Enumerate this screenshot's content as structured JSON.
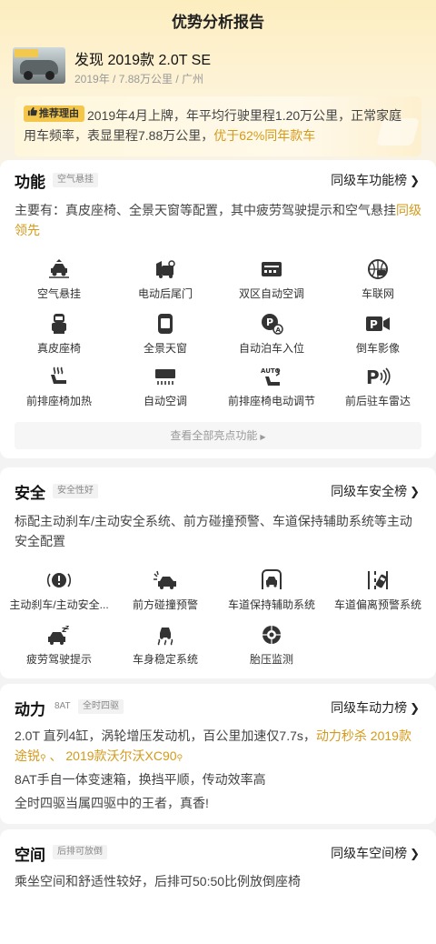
{
  "nav": {
    "title": "优势分析报告"
  },
  "car": {
    "name": "发现 2019款 2.0T SE",
    "subtitle": "2019年 / 7.88万公里 / 广州"
  },
  "reason": {
    "badge": "推荐理由",
    "text_plain": "2019年4月上牌，年平均行驶里程1.20万公里，正常家庭用车频率，表显里程7.88万公里，",
    "text_highlight": "优于62%同年款车"
  },
  "feature": {
    "title": "功能",
    "tag": "空气悬挂",
    "link": "同级车功能榜",
    "desc_plain": "主要有：真皮座椅、全景天窗等配置，其中疲劳驾驶提示和空气悬挂",
    "desc_highlight": "同级领先",
    "items": [
      {
        "label": "空气悬挂",
        "icon": "air-suspension-icon"
      },
      {
        "label": "电动后尾门",
        "icon": "power-tailgate-icon"
      },
      {
        "label": "双区自动空调",
        "icon": "dual-zone-ac-icon"
      },
      {
        "label": "车联网",
        "icon": "connected-car-icon"
      },
      {
        "label": "真皮座椅",
        "icon": "leather-seat-icon"
      },
      {
        "label": "全景天窗",
        "icon": "panoramic-sunroof-icon"
      },
      {
        "label": "自动泊车入位",
        "icon": "auto-parking-icon"
      },
      {
        "label": "倒车影像",
        "icon": "reverse-camera-icon"
      },
      {
        "label": "前排座椅加热",
        "icon": "seat-heating-icon"
      },
      {
        "label": "自动空调",
        "icon": "auto-ac-icon"
      },
      {
        "label": "前排座椅电动调节",
        "icon": "power-seat-adjust-icon"
      },
      {
        "label": "前后驻车雷达",
        "icon": "parking-radar-icon"
      }
    ],
    "view_all": "查看全部亮点功能"
  },
  "safety": {
    "title": "安全",
    "tag": "安全性好",
    "link": "同级车安全榜",
    "desc": "标配主动刹车/主动安全系统、前方碰撞预警、车道保持辅助系统等主动安全配置",
    "items": [
      {
        "label": "主动刹车/主动安全...",
        "icon": "active-brake-icon"
      },
      {
        "label": "前方碰撞预警",
        "icon": "collision-warning-icon"
      },
      {
        "label": "车道保持辅助系统",
        "icon": "lane-keep-icon"
      },
      {
        "label": "车道偏离预警系统",
        "icon": "lane-departure-icon"
      },
      {
        "label": "疲劳驾驶提示",
        "icon": "fatigue-alert-icon"
      },
      {
        "label": "车身稳定系统",
        "icon": "stability-control-icon"
      },
      {
        "label": "胎压监测",
        "icon": "tire-pressure-icon"
      }
    ]
  },
  "power": {
    "title": "动力",
    "tags": [
      "8AT",
      "全时四驱"
    ],
    "link": "同级车动力榜",
    "line1_plain": "2.0T 直列4缸，涡轮增压发动机，百公里加速仅7.7s，",
    "line1_hl1": "动力秒杀 2019款途锐",
    "line1_sep": " 、 ",
    "line1_hl2": "2019款沃尔沃XC90",
    "line2": "8AT手自一体变速箱，换挡平顺，传动效率高",
    "line3": "全时四驱当属四驱中的王者，真香!"
  },
  "space": {
    "title": "空间",
    "tag": "后排可放倒",
    "link": "同级车空间榜",
    "desc": "乘坐空间和舒适性较好，后排可50:50比例放倒座椅"
  },
  "colors": {
    "accent": "#d49a1a",
    "badge": "#f4c74a",
    "icon": "#333333"
  }
}
